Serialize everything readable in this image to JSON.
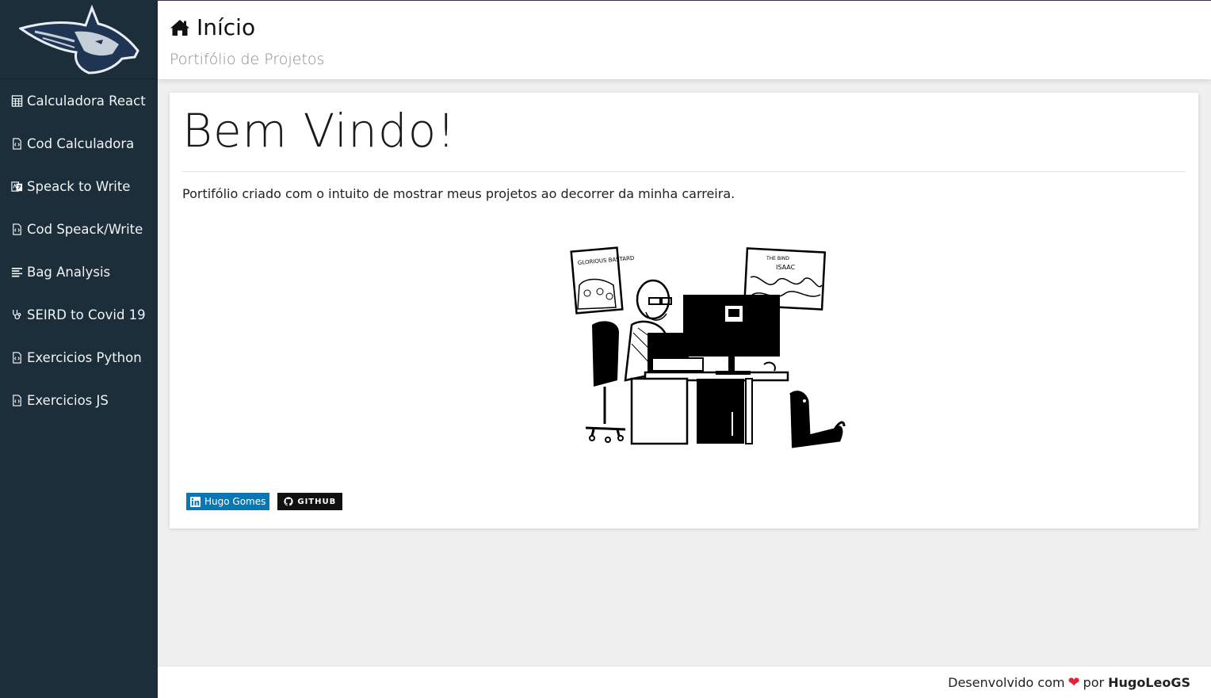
{
  "header": {
    "title": "Início",
    "subtitle": "Portifólio de Projetos"
  },
  "sidebar": {
    "items": [
      {
        "label": "Calculadora React",
        "icon": "calculator-icon"
      },
      {
        "label": "Cod Calculadora",
        "icon": "code-file-icon"
      },
      {
        "label": "Speack to Write",
        "icon": "language-icon"
      },
      {
        "label": "Cod Speack/Write",
        "icon": "code-file-icon"
      },
      {
        "label": "Bag Analysis",
        "icon": "align-left-icon"
      },
      {
        "label": "SEIRD to Covid 19",
        "icon": "stethoscope-icon"
      },
      {
        "label": "Exercicios Python",
        "icon": "code-file-icon"
      },
      {
        "label": "Exercicios JS",
        "icon": "code-file-icon"
      }
    ]
  },
  "main": {
    "heading": "Bem Vindo!",
    "intro": "Portifólio criado com o intuito de mostrar meus projetos ao decorrer da minha carreira.",
    "illustration": {
      "left_poster": "GLORIOUS BASTARD",
      "right_poster_top": "THE BIND",
      "right_poster_bottom": "ISAAC"
    },
    "badges": {
      "linkedin": "Hugo Gomes",
      "github": "GITHUB"
    }
  },
  "footer": {
    "prefix": "Desenvolvido com",
    "middle": "por",
    "author": "HugoLeoGS"
  },
  "colors": {
    "sidebar_bg": "#1c2e3a",
    "linkedin": "#0a77b5",
    "heart": "#e0253a"
  }
}
